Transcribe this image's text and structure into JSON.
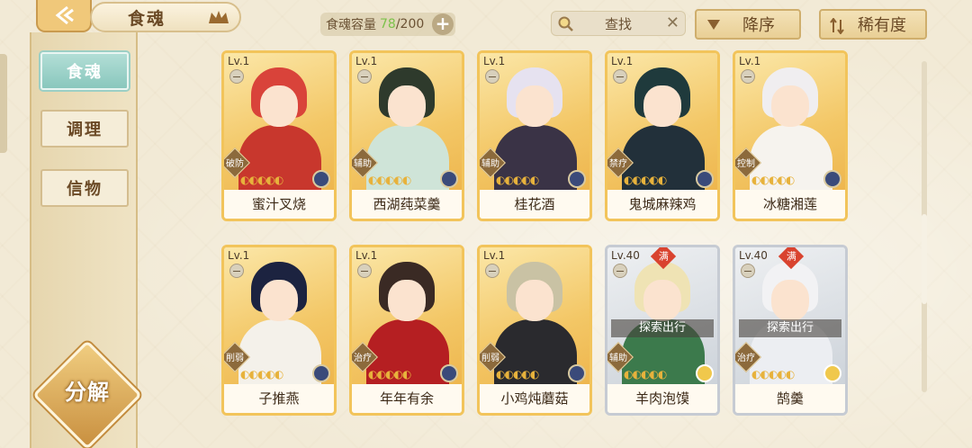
{
  "header": {
    "title": "食魂",
    "capacity_label": "食魂容量",
    "capacity_current": "78",
    "capacity_max": "/200",
    "search_placeholder": "查找",
    "sort_order": "降序",
    "sort_by": "稀有度"
  },
  "sidebar": {
    "tabs": [
      {
        "label": "食魂",
        "active": true
      },
      {
        "label": "调理",
        "active": false
      },
      {
        "label": "信物",
        "active": false
      }
    ],
    "decompose_label": "分解"
  },
  "cards": [
    {
      "name": "蜜汁叉烧",
      "level": "Lv.1",
      "role": "破防",
      "rarity": "gold",
      "hair": "#d9433a",
      "outfit": "#c8372d"
    },
    {
      "name": "西湖莼菜羹",
      "level": "Lv.1",
      "role": "辅助",
      "rarity": "gold",
      "hair": "#2e3a2c",
      "outfit": "#cfe4d8"
    },
    {
      "name": "桂花酒",
      "level": "Lv.1",
      "role": "辅助",
      "rarity": "gold",
      "hair": "#e6e2f0",
      "outfit": "#3a3346"
    },
    {
      "name": "鬼城麻辣鸡",
      "level": "Lv.1",
      "role": "禁疗",
      "rarity": "gold",
      "hair": "#1f3a3c",
      "outfit": "#22303a"
    },
    {
      "name": "冰糖湘莲",
      "level": "Lv.1",
      "role": "控制",
      "rarity": "gold",
      "hair": "#f0eef0",
      "outfit": "#f6f3ee"
    },
    {
      "name": "子推燕",
      "level": "Lv.1",
      "role": "削弱",
      "rarity": "gold",
      "hair": "#1c2340",
      "outfit": "#f4f1ea"
    },
    {
      "name": "年年有余",
      "level": "Lv.1",
      "role": "治疗",
      "rarity": "gold",
      "hair": "#3a2a24",
      "outfit": "#b51f22"
    },
    {
      "name": "小鸡炖蘑菇",
      "level": "Lv.1",
      "role": "削弱",
      "rarity": "gold",
      "hair": "#c9c2a4",
      "outfit": "#2a2a2e"
    },
    {
      "name": "羊肉泡馍",
      "level": "Lv.40",
      "role": "辅助",
      "rarity": "silver",
      "hair": "#efe3b4",
      "outfit": "#3c7a4c",
      "tag": "探索出行",
      "full": "满"
    },
    {
      "name": "鹄羹",
      "level": "Lv.40",
      "role": "治疗",
      "rarity": "silver",
      "hair": "#f2f2f4",
      "outfit": "#eceef2",
      "tag": "探索出行",
      "full": "满"
    }
  ]
}
